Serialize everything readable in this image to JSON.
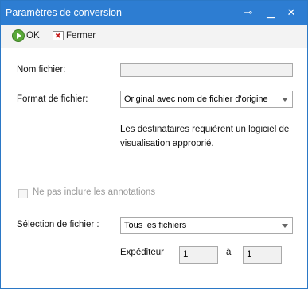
{
  "window": {
    "title": "Paramètres de conversion"
  },
  "titlebar": {
    "pin_icon": "pin-icon",
    "minimize_icon": "minimize-icon",
    "close_icon": "close-icon"
  },
  "toolbar": {
    "ok_label": "OK",
    "close_label": "Fermer"
  },
  "form": {
    "file_name_label": "Nom fichier:",
    "file_name_value": "",
    "file_format_label": "Format de fichier:",
    "file_format_value": "Original avec nom de fichier d'origine",
    "note": "Les destinataires requièrent un logiciel de visualisation approprié.",
    "exclude_annotations_label": "Ne pas inclure les annotations",
    "file_selection_label": "Sélection de fichier :",
    "file_selection_value": "Tous les fichiers",
    "sender_label": "Expéditeur",
    "range_from": "1",
    "range_to_label": "à",
    "range_to": "1"
  },
  "colors": {
    "titlebar": "#2d7dd2",
    "ok_green": "#5aa83a",
    "close_red": "#c81e1e"
  }
}
